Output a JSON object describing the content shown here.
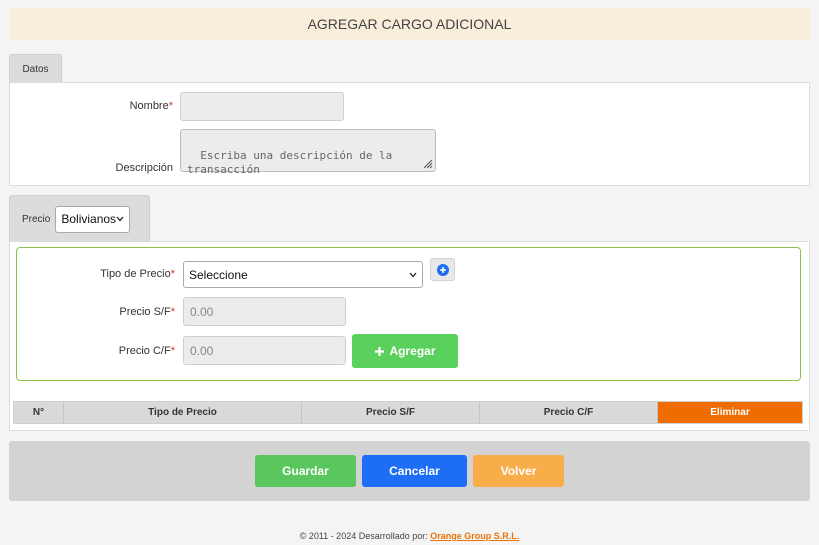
{
  "header": {
    "title": "AGREGAR CARGO ADICIONAL"
  },
  "tabs": {
    "datos": "Datos",
    "precio": "Precio"
  },
  "datos": {
    "nombre_label": "Nombre",
    "nombre_value": "",
    "descripcion_label": "Descripción",
    "descripcion_placeholder": "Escriba una descripción de la transacción"
  },
  "precio": {
    "currency_selected": "Bolivianos",
    "tipo_label": "Tipo de Precio",
    "tipo_selected": "Seleccione",
    "sf_label": "Precio S/F",
    "sf_placeholder": "0.00",
    "cf_label": "Precio C/F",
    "cf_placeholder": "0.00",
    "agregar_label": "Agregar",
    "required_mark": "*"
  },
  "table": {
    "headers": [
      "N°",
      "Tipo de Precio",
      "Precio S/F",
      "Precio C/F",
      "Eliminar"
    ]
  },
  "actions": {
    "guardar": "Guardar",
    "cancelar": "Cancelar",
    "volver": "Volver"
  },
  "footer": {
    "copyright": "© 2011 - 2024 Desarrollado por:",
    "company": "Orange Group S.R.L."
  },
  "colors": {
    "guardar": "#59c75d",
    "cancelar": "#1e6ef5",
    "volver": "#f9ad4a",
    "eliminar_header": "#ef6c00",
    "agregar": "#5bd15d",
    "accent_green": "#8bc34a"
  },
  "icons": {
    "add_tipo": "plus-circle-icon",
    "agregar": "plus-icon",
    "select_arrow": "chevron-down-icon"
  }
}
